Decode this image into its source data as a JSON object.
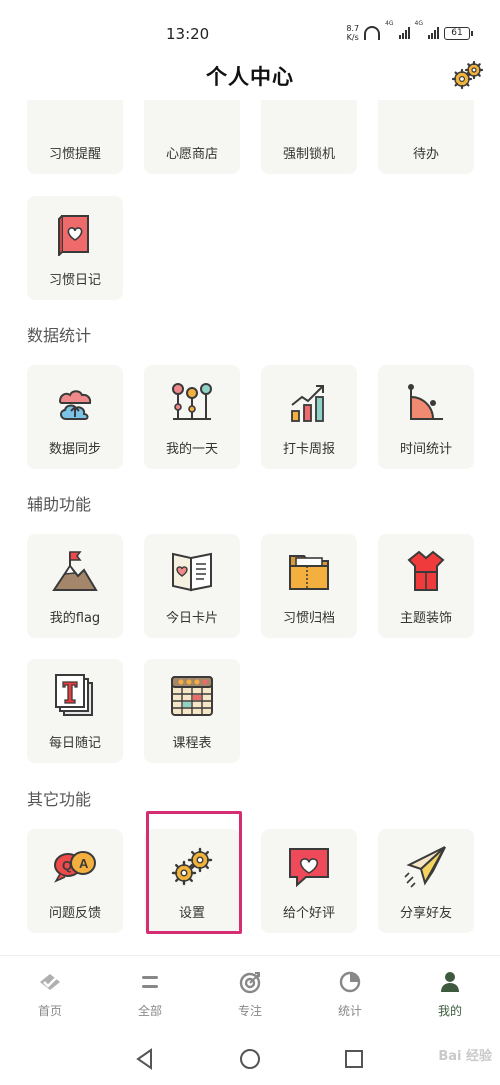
{
  "status": {
    "time": "13:20",
    "net_speed_value": "8.7",
    "net_speed_unit": "K/s",
    "sim1_label": "4G",
    "sim2_label": "4G",
    "battery": "61"
  },
  "header": {
    "title": "个人中心",
    "settings_icon": "gears-icon"
  },
  "top_row": [
    {
      "label": "习惯提醒",
      "icon": "alarm-clock-icon"
    },
    {
      "label": "心愿商店",
      "icon": "shopping-cart-icon"
    },
    {
      "label": "强制锁机",
      "icon": "lock-phone-icon"
    },
    {
      "label": "待办",
      "icon": "todo-note-icon"
    }
  ],
  "habit_diary": {
    "label": "习惯日记",
    "icon": "heart-book-icon"
  },
  "sections": {
    "data_stats": {
      "title": "数据统计",
      "items": [
        {
          "label": "数据同步",
          "icon": "cloud-sync-icon"
        },
        {
          "label": "我的一天",
          "icon": "timeline-icon"
        },
        {
          "label": "打卡周报",
          "icon": "bar-chart-icon"
        },
        {
          "label": "时间统计",
          "icon": "pie-chart-icon"
        }
      ]
    },
    "aux": {
      "title": "辅助功能",
      "items": [
        {
          "label": "我的flag",
          "icon": "mountain-flag-icon"
        },
        {
          "label": "今日卡片",
          "icon": "heart-card-icon"
        },
        {
          "label": "习惯归档",
          "icon": "folder-icon"
        },
        {
          "label": "主题装饰",
          "icon": "dress-icon"
        },
        {
          "label": "每日随记",
          "icon": "text-note-icon"
        },
        {
          "label": "课程表",
          "icon": "calendar-icon"
        }
      ]
    },
    "other": {
      "title": "其它功能",
      "items": [
        {
          "label": "问题反馈",
          "icon": "qa-bubble-icon"
        },
        {
          "label": "设置",
          "icon": "gears-icon"
        },
        {
          "label": "给个好评",
          "icon": "heart-message-icon"
        },
        {
          "label": "分享好友",
          "icon": "paper-plane-icon"
        }
      ]
    }
  },
  "tabs": [
    {
      "label": "首页",
      "icon": "home-check-icon",
      "active": false
    },
    {
      "label": "全部",
      "icon": "list-icon",
      "active": false
    },
    {
      "label": "专注",
      "icon": "focus-target-icon",
      "active": false
    },
    {
      "label": "统计",
      "icon": "stats-pie-icon",
      "active": false
    },
    {
      "label": "我的",
      "icon": "person-icon",
      "active": true
    }
  ],
  "watermark": "Bai 经验",
  "colors": {
    "accent": "#3d5a3e",
    "highlight": "#d62c72",
    "card_bg": "#f6f6f2"
  }
}
